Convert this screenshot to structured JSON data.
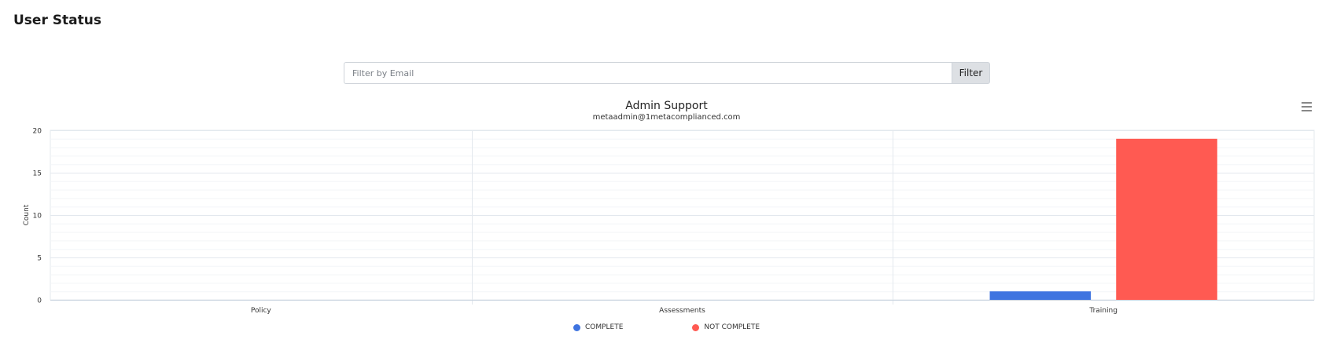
{
  "page": {
    "title": "User Status"
  },
  "filter": {
    "placeholder": "Filter by Email",
    "value": "",
    "button_label": "Filter"
  },
  "colors": {
    "complete": "#3f74e0",
    "not_complete": "#ff5a52",
    "grid": "#e3e8ee",
    "minor_grid": "#f3f5f8",
    "axis": "#c9d3df"
  },
  "chart_data": {
    "type": "bar",
    "title": "Admin Support",
    "subtitle": "metaadmin@1metacomplianced.com",
    "categories": [
      "Policy",
      "Assessments",
      "Training"
    ],
    "series": [
      {
        "name": "COMPLETE",
        "values": [
          0,
          0,
          1
        ]
      },
      {
        "name": "NOT COMPLETE",
        "values": [
          0,
          0,
          19
        ]
      }
    ],
    "xlabel": "",
    "ylabel": "Count",
    "ylim": [
      0,
      20
    ],
    "yticks": [
      0,
      5,
      10,
      15,
      20
    ],
    "grid": true,
    "legend": "bottom-center",
    "menu_icon": "hamburger-menu-icon"
  }
}
